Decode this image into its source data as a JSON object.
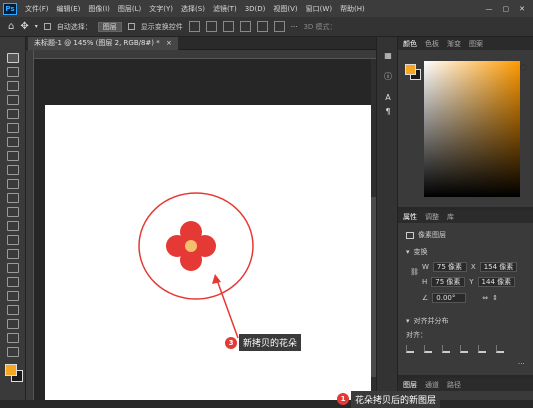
{
  "menubar": {
    "logo": "Ps",
    "items": [
      "文件(F)",
      "编辑(E)",
      "图像(I)",
      "图层(L)",
      "文字(Y)",
      "选择(S)",
      "滤镜(T)",
      "3D(D)",
      "视图(V)",
      "窗口(W)",
      "帮助(H)"
    ],
    "controls": [
      "—",
      "▢",
      "✕"
    ]
  },
  "options": {
    "auto_select_label": "自动选择：",
    "auto_select_value": "图层",
    "show_transform_label": "显示变换控件",
    "mode_3d": "3D 模式："
  },
  "document": {
    "tab_title": "未标题-1 @ 145% (图层 2, RGB/8#) *",
    "tab_close": "×"
  },
  "color_panel": {
    "tabs": [
      "颜色",
      "色板",
      "渐变",
      "图案"
    ],
    "active_tab": "颜色"
  },
  "properties_panel": {
    "tabs": [
      "属性",
      "调整",
      "库"
    ],
    "active_tab": "属性",
    "layer_type": "像素图层",
    "transform_header": "变换",
    "w_label": "W",
    "w_value": "75 像素",
    "h_label": "H",
    "h_value": "75 像素",
    "x_label": "X",
    "x_value": "154 像素",
    "y_label": "Y",
    "y_value": "144 像素",
    "angle_value": "0.00°",
    "align_header": "对齐并分布",
    "align_label": "对齐："
  },
  "layers_panel": {
    "tabs": [
      "图层",
      "通道",
      "路径"
    ],
    "active_tab": "图层"
  },
  "annotations": [
    {
      "number": "3",
      "text": "新拷贝的花朵"
    },
    {
      "number": "1",
      "text": "花朵拷贝后的新图层"
    }
  ],
  "colors": {
    "foreground": "#f5a623",
    "background": "#1a1a1a",
    "flower_petal": "#e53935",
    "flower_center": "#f4c070",
    "annotation_red": "#e53935"
  },
  "icons": {
    "home": "home-icon",
    "move": "move-icon"
  }
}
